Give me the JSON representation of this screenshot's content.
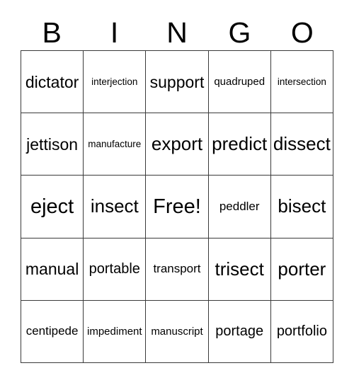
{
  "card": {
    "title": "BINGO",
    "header_letters": [
      "B",
      "I",
      "N",
      "G",
      "O"
    ],
    "grid_size": "5x5",
    "free_space": "Free!",
    "text_color": "#000000",
    "grid_line_color": "#3a3a3a",
    "background_color": "#ffffff",
    "rows": [
      [
        {
          "text": "dictator",
          "size": "fs-lg"
        },
        {
          "text": "interjection",
          "size": "fs-xxs"
        },
        {
          "text": "support",
          "size": "fs-lg"
        },
        {
          "text": "quadruped",
          "size": "fs-xs"
        },
        {
          "text": "intersection",
          "size": "fs-xxs"
        }
      ],
      [
        {
          "text": "jettison",
          "size": "fs-lg"
        },
        {
          "text": "manufacture",
          "size": "fs-xxs"
        },
        {
          "text": "export",
          "size": "fs-xl"
        },
        {
          "text": "predict",
          "size": "fs-xl"
        },
        {
          "text": "dissect",
          "size": "fs-xl"
        }
      ],
      [
        {
          "text": "eject",
          "size": "fs-xxl"
        },
        {
          "text": "insect",
          "size": "fs-xl"
        },
        {
          "text": "Free!",
          "size": "fs-xxl"
        },
        {
          "text": "peddler",
          "size": "fs-sm"
        },
        {
          "text": "bisect",
          "size": "fs-xl"
        }
      ],
      [
        {
          "text": "manual",
          "size": "fs-lg"
        },
        {
          "text": "portable",
          "size": "fs-md"
        },
        {
          "text": "transport",
          "size": "fs-sm"
        },
        {
          "text": "trisect",
          "size": "fs-xl"
        },
        {
          "text": "porter",
          "size": "fs-xl"
        }
      ],
      [
        {
          "text": "centipede",
          "size": "fs-sm"
        },
        {
          "text": "impediment",
          "size": "fs-xs"
        },
        {
          "text": "manuscript",
          "size": "fs-xs"
        },
        {
          "text": "portage",
          "size": "fs-md"
        },
        {
          "text": "portfolio",
          "size": "fs-md"
        }
      ]
    ]
  }
}
